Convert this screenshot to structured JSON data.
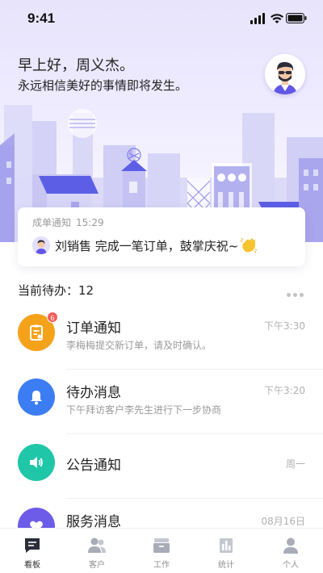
{
  "status_bar": {
    "time": "9:41"
  },
  "header": {
    "greeting": "早上好，周义杰。",
    "slogan": "永远相信美好的事情即将发生。"
  },
  "notice": {
    "label": "成单通知",
    "time": "15:29",
    "message": "刘销售 完成一笔订单，鼓掌庆祝~"
  },
  "todo": {
    "title": "当前待办：12"
  },
  "messages": [
    {
      "title": "订单通知",
      "subtitle": "李梅梅提交新订单，请及时确认。",
      "time": "下午3:30",
      "badge": "6",
      "icon": "clipboard-icon",
      "color": "#f5a21b"
    },
    {
      "title": "待办消息",
      "subtitle": "下午拜访客户李先生进行下一步协商",
      "time": "下午3:20",
      "icon": "bell-icon",
      "color": "#3d7df4"
    },
    {
      "title": "公告通知",
      "subtitle": "",
      "time": "周一",
      "icon": "speaker-icon",
      "color": "#1fc6a7"
    },
    {
      "title": "服务消息",
      "subtitle": "",
      "time": "08月16日",
      "icon": "heart-icon",
      "color": "#6c5ce7"
    }
  ],
  "tabs": [
    {
      "label": "看板",
      "icon": "board-icon",
      "active": true
    },
    {
      "label": "客户",
      "icon": "customers-icon",
      "active": false
    },
    {
      "label": "工作",
      "icon": "work-icon",
      "active": false
    },
    {
      "label": "统计",
      "icon": "stats-icon",
      "active": false
    },
    {
      "label": "个人",
      "icon": "person-icon",
      "active": false
    }
  ],
  "colors": {
    "accent": "#5b5fe8",
    "city_light": "#c9c8f4",
    "city_mid": "#a9a6ee",
    "city_dark": "#5c5fe6"
  }
}
